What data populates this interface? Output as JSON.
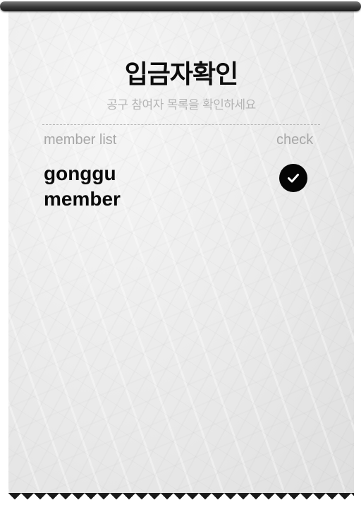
{
  "page": {
    "title": "입금자확인",
    "subtitle": "공구 참여자 목록을 확인하세요"
  },
  "list": {
    "header_member": "member list",
    "header_check": "check",
    "members": [
      {
        "name": "gonggu member",
        "checked": true
      }
    ]
  },
  "icons": {
    "check": "check-circle-icon"
  },
  "colors": {
    "title": "#0c0c0c",
    "subtitle": "#b4b4b4",
    "header": "#a7a7a7",
    "check_bg": "#050505",
    "roller": "#2e2e2e"
  }
}
